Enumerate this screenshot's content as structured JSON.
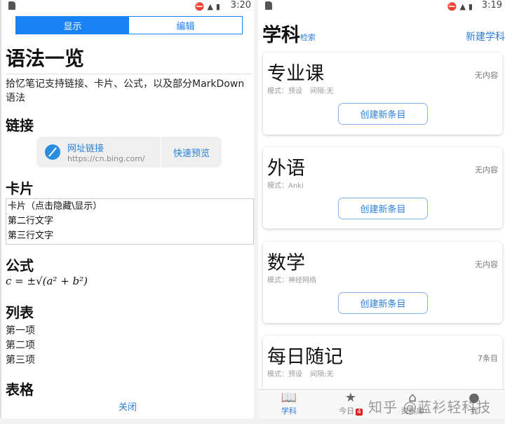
{
  "left": {
    "status": {
      "time": "3:20"
    },
    "segments": [
      "显示",
      "编辑"
    ],
    "title": "语法一览",
    "intro": "拾忆笔记支持链接、卡片、公式，以及部分MarkDown语法",
    "sections": {
      "link": "链接",
      "card": "卡片",
      "formula": "公式",
      "list": "列表",
      "table": "表格"
    },
    "link": {
      "title": "网址链接",
      "url": "https://cn.bing.com/",
      "preview": "快速预览"
    },
    "card_lines": [
      "卡片（点击隐藏\\显示）",
      "第二行文字",
      "第三行文字"
    ],
    "formula": "c = ±√(a² + b²)",
    "list_items": [
      "第一项",
      "第二项",
      "第三项"
    ],
    "close": "关闭"
  },
  "right": {
    "status": {
      "time": "3:19"
    },
    "title": "学科",
    "search": "检索",
    "new_subject": "新建学科",
    "subjects": [
      {
        "name": "专业课",
        "count": "无内容",
        "meta": "模式：预设 间隔:无",
        "button": "创建新条目"
      },
      {
        "name": "外语",
        "count": "无内容",
        "meta": "模式：Anki",
        "button": "创建新条目"
      },
      {
        "name": "数学",
        "count": "无内容",
        "meta": "模式：神经网络",
        "button": "创建新条目"
      },
      {
        "name": "每日随记",
        "count": "7条目",
        "meta": "模式：预设 间隔:无"
      }
    ],
    "tabs": [
      {
        "label": "学科"
      },
      {
        "label": "今日",
        "badge": "4"
      },
      {
        "label": "资料库"
      },
      {
        "label": "我"
      }
    ],
    "watermark": "知乎 @蓝衫轻科技"
  },
  "colors": {
    "accent": "#1a82f5"
  }
}
